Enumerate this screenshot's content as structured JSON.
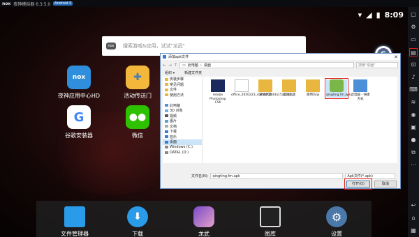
{
  "window": {
    "title": "夜神模拟器 6.3.5.0",
    "android_badge": "Android 5"
  },
  "status": {
    "time": "8:09"
  },
  "search": {
    "placeholder": "搜索游戏&应用，试试\"龙武\""
  },
  "desktop_apps": [
    {
      "label": "夜神应用中心HD",
      "icon": "nox-app-center-icon"
    },
    {
      "label": "活动传送门",
      "icon": "gamepad-icon"
    },
    {
      "label": "谷歌安装器",
      "icon": "google-icon"
    },
    {
      "label": "微信",
      "icon": "wechat-icon"
    }
  ],
  "dock": [
    {
      "label": "文件管理器",
      "icon": "folder-icon"
    },
    {
      "label": "下载",
      "icon": "download-icon"
    },
    {
      "label": "龙武",
      "icon": "game-character-icon"
    },
    {
      "label": "图库",
      "icon": "gallery-icon"
    },
    {
      "label": "设置",
      "icon": "gear-icon"
    }
  ],
  "dialog": {
    "title": "添加apk文件",
    "path": [
      "此电脑",
      "桌面"
    ],
    "search_placeholder": "搜索\"桌面\"",
    "organize": "组织 ▾",
    "new_folder": "新建文件夹",
    "tree": [
      {
        "label": "安装步骤",
        "type": "folder"
      },
      {
        "label": "常见问题",
        "type": "folder"
      },
      {
        "label": "文件",
        "type": "folder"
      },
      {
        "label": "使用方法",
        "type": "folder"
      },
      {
        "label": "",
        "type": "blank"
      },
      {
        "label": "此电脑",
        "type": "pc"
      },
      {
        "label": "3D 对象",
        "type": "folder"
      },
      {
        "label": "视频",
        "type": "folder"
      },
      {
        "label": "图片",
        "type": "folder"
      },
      {
        "label": "文档",
        "type": "folder"
      },
      {
        "label": "下载",
        "type": "folder"
      },
      {
        "label": "音乐",
        "type": "folder"
      },
      {
        "label": "桌面",
        "type": "folder",
        "selected": true
      },
      {
        "label": "Windows (C:)",
        "type": "drive"
      },
      {
        "label": "DATA1 (D:)",
        "type": "drive"
      }
    ],
    "files": [
      {
        "label": "Adobe Photoshop CS6",
        "kind": "ps"
      },
      {
        "label": "office_2650223_d1f58025d4a15a1c45...",
        "kind": "doc"
      },
      {
        "label": "安装步骤",
        "kind": "folder"
      },
      {
        "label": "常见问题",
        "kind": "folder"
      },
      {
        "label": "使用方法",
        "kind": "folder"
      },
      {
        "label": "qingting.fm.apk",
        "kind": "apk",
        "selected": true
      },
      {
        "label": "此电脑 - 快捷方式",
        "kind": "pc"
      }
    ],
    "filename_label": "文件名(N):",
    "filename_value": "qingting.fm.apk",
    "filetype": "Apk文件(*.apk)",
    "open": "打开(O)",
    "cancel": "取消"
  },
  "colors": {
    "highlight": "#e0201c",
    "accent": "#2b6fb8"
  }
}
